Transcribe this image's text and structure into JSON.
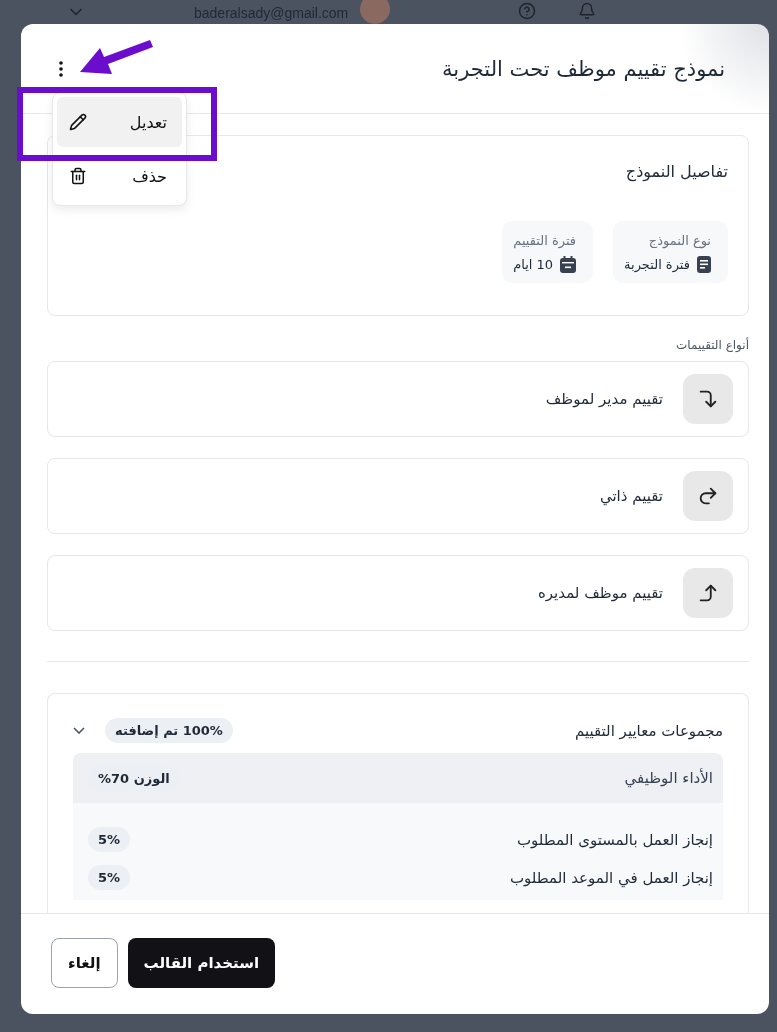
{
  "background": {
    "email": "baderalsady@gmail.com"
  },
  "dialog": {
    "title": "نموذج تقييم موظف تحت التجربة",
    "menu": [
      {
        "label": "تعديل",
        "kind": "edit",
        "selected": true
      },
      {
        "label": "حذف",
        "kind": "delete",
        "selected": false
      }
    ],
    "details": {
      "title": "تفاصيل النموذج",
      "fields": [
        {
          "label": "نوع النموذج",
          "value": "فترة التجربة",
          "kind": "document"
        },
        {
          "label": "فترة التقييم",
          "value": "10 ايام",
          "kind": "calendar"
        }
      ]
    },
    "types_label": "أنواع التقييمات",
    "types": [
      {
        "label": "تقييم مدير لموظف",
        "kind": "down"
      },
      {
        "label": "تقييم ذاتي",
        "kind": "forward"
      },
      {
        "label": "تقييم موظف لمديره",
        "kind": "up"
      }
    ],
    "criteria": {
      "title": "مجموعات معايير التقييم",
      "badge": "100% تم إضافته",
      "expanded": true,
      "groups": [
        {
          "name": "الأداء الوظيفي",
          "weight": "الوزن 70%",
          "items": [
            {
              "name": "إنجاز العمل بالمستوى المطلوب",
              "weight": "5%"
            },
            {
              "name": "إنجاز العمل في الموعد المطلوب",
              "weight": "5%"
            }
          ]
        }
      ]
    },
    "buttons": [
      {
        "label": "استخدام القالب",
        "kind": "primary"
      },
      {
        "label": "إلغاء",
        "kind": "secondary"
      }
    ]
  }
}
